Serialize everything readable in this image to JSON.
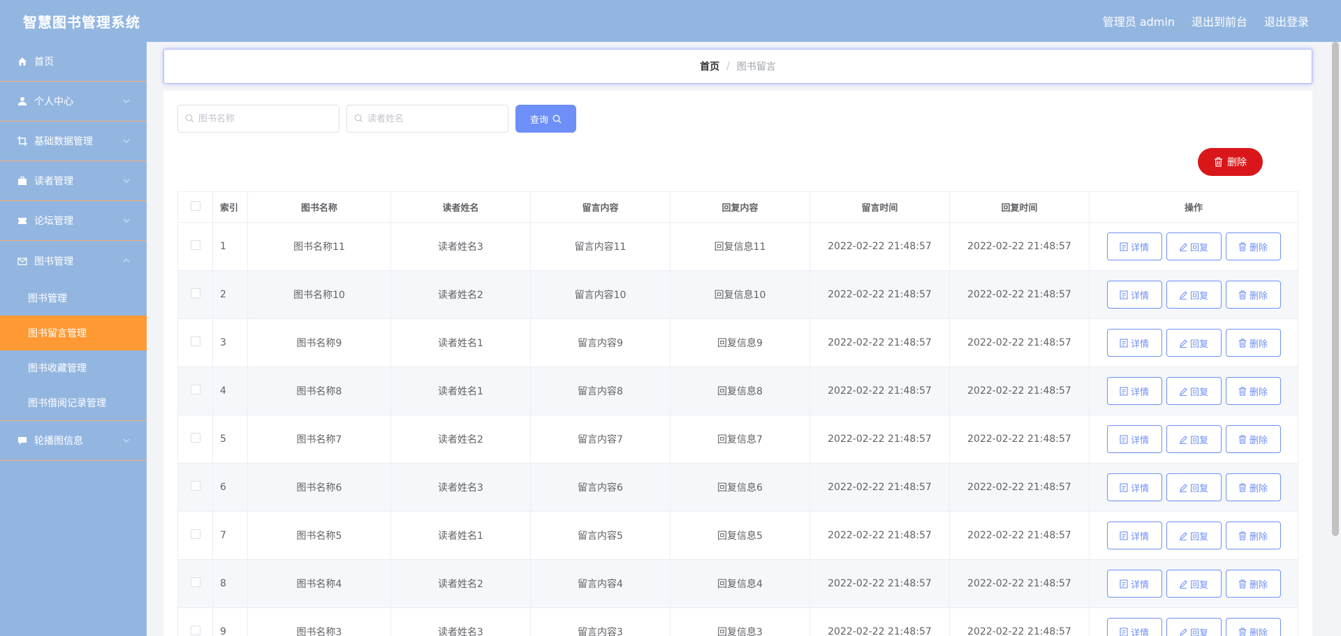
{
  "app": {
    "title": "智慧图书管理系统"
  },
  "topbar": {
    "links": [
      "管理员 admin",
      "退出到前台",
      "退出登录"
    ]
  },
  "sidebar": {
    "items": [
      {
        "label": "首页",
        "icon": "home-icon",
        "expandable": false
      },
      {
        "label": "个人中心",
        "icon": "user-icon",
        "expandable": true
      },
      {
        "label": "基础数据管理",
        "icon": "crop-icon",
        "expandable": true
      },
      {
        "label": "读者管理",
        "icon": "suitcase-icon",
        "expandable": true
      },
      {
        "label": "论坛管理",
        "icon": "ticket-icon",
        "expandable": true
      },
      {
        "label": "图书管理",
        "icon": "mail-icon",
        "expandable": true,
        "expanded": true,
        "children": [
          "图书管理",
          "图书留言管理",
          "图书收藏管理",
          "图书借阅记录管理"
        ],
        "active_child": 1
      },
      {
        "label": "轮播图信息",
        "icon": "chat-icon",
        "expandable": true
      }
    ]
  },
  "breadcrumb": {
    "home": "首页",
    "separator": "/",
    "current": "图书留言"
  },
  "search": {
    "book_placeholder": "图书名称",
    "reader_placeholder": "读者姓名",
    "query_label": "查询"
  },
  "actions": {
    "delete_label": "删除"
  },
  "table": {
    "headers": [
      "索引",
      "图书名称",
      "读者姓名",
      "留言内容",
      "回复内容",
      "留言时间",
      "回复时间",
      "操作"
    ],
    "row_actions": [
      "详情",
      "回复",
      "删除"
    ],
    "rows": [
      [
        "1",
        "图书名称11",
        "读者姓名3",
        "留言内容11",
        "回复信息11",
        "2022-02-22 21:48:57",
        "2022-02-22 21:48:57"
      ],
      [
        "2",
        "图书名称10",
        "读者姓名2",
        "留言内容10",
        "回复信息10",
        "2022-02-22 21:48:57",
        "2022-02-22 21:48:57"
      ],
      [
        "3",
        "图书名称9",
        "读者姓名1",
        "留言内容9",
        "回复信息9",
        "2022-02-22 21:48:57",
        "2022-02-22 21:48:57"
      ],
      [
        "4",
        "图书名称8",
        "读者姓名1",
        "留言内容8",
        "回复信息8",
        "2022-02-22 21:48:57",
        "2022-02-22 21:48:57"
      ],
      [
        "5",
        "图书名称7",
        "读者姓名2",
        "留言内容7",
        "回复信息7",
        "2022-02-22 21:48:57",
        "2022-02-22 21:48:57"
      ],
      [
        "6",
        "图书名称6",
        "读者姓名3",
        "留言内容6",
        "回复信息6",
        "2022-02-22 21:48:57",
        "2022-02-22 21:48:57"
      ],
      [
        "7",
        "图书名称5",
        "读者姓名1",
        "留言内容5",
        "回复信息5",
        "2022-02-22 21:48:57",
        "2022-02-22 21:48:57"
      ],
      [
        "8",
        "图书名称4",
        "读者姓名2",
        "留言内容4",
        "回复信息4",
        "2022-02-22 21:48:57",
        "2022-02-22 21:48:57"
      ],
      [
        "9",
        "图书名称3",
        "读者姓名3",
        "留言内容3",
        "回复信息3",
        "2022-02-22 21:48:57",
        "2022-02-22 21:48:57"
      ]
    ]
  },
  "colors": {
    "topbar": "#93b6e1",
    "active_menu": "#ff9933",
    "primary": "#6e8ff7",
    "danger": "#d9171a"
  }
}
